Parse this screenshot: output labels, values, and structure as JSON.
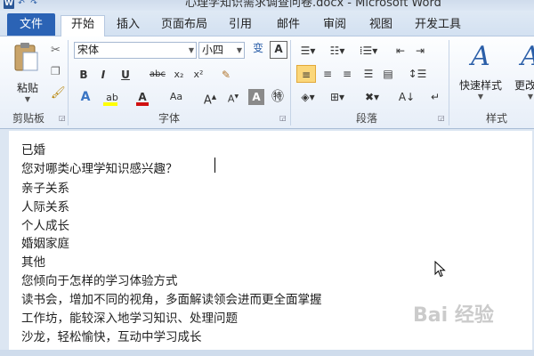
{
  "title_bar": {
    "title": "心理学知识需求调查问卷.docx - Microsoft Word"
  },
  "qat": [
    "W",
    "↶",
    "↷"
  ],
  "tabs": {
    "file": "文件",
    "items": [
      "开始",
      "插入",
      "页面布局",
      "引用",
      "邮件",
      "审阅",
      "视图",
      "开发工具"
    ],
    "active": "开始"
  },
  "ribbon": {
    "clipboard": {
      "label": "剪贴板",
      "paste": "粘贴"
    },
    "font": {
      "label": "字体",
      "font_name": "宋体",
      "font_size": "小四",
      "wen": "wén\n变"
    },
    "paragraph": {
      "label": "段落"
    },
    "styles": {
      "label": "样式",
      "quick_styles": "快速样式",
      "change_styles": "更改样"
    }
  },
  "document": {
    "lines": [
      "已婚",
      "您对哪类心理学知识感兴趣？",
      "亲子关系",
      "人际关系",
      "个人成长",
      "婚姻家庭",
      "其他",
      "您倾向于怎样的学习体验方式",
      "读书会，增加不同的视角，多面解读领会进而更全面掌握",
      "工作坊，能较深入地学习知识、处理问题",
      "沙龙，轻松愉快，互动中学习成长"
    ]
  },
  "watermark": "Bai 经验"
}
